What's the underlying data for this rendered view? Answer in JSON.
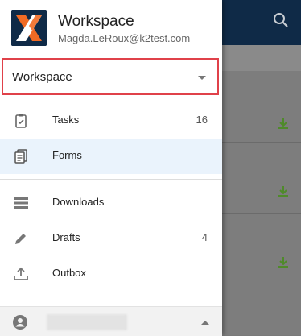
{
  "profile": {
    "title": "Workspace",
    "email": "Magda.LeRoux@k2test.com",
    "logo_icon": "k2-logo"
  },
  "workspace_select": {
    "value": "Workspace"
  },
  "menu": {
    "items": [
      {
        "label": "Tasks",
        "count": "16",
        "icon": "clipboard-check-icon"
      },
      {
        "label": "Forms",
        "count": "",
        "icon": "forms-icon",
        "selected": true
      },
      {
        "label": "Downloads",
        "count": "",
        "icon": "downloads-list-icon"
      },
      {
        "label": "Drafts",
        "count": "4",
        "icon": "pencil-icon"
      },
      {
        "label": "Outbox",
        "count": "",
        "icon": "outbox-icon"
      }
    ]
  },
  "colors": {
    "brand": "#0f2a47",
    "accent_orange": "#f06a24",
    "highlight_border": "#e0414a",
    "download_green": "#4f8a2a"
  }
}
